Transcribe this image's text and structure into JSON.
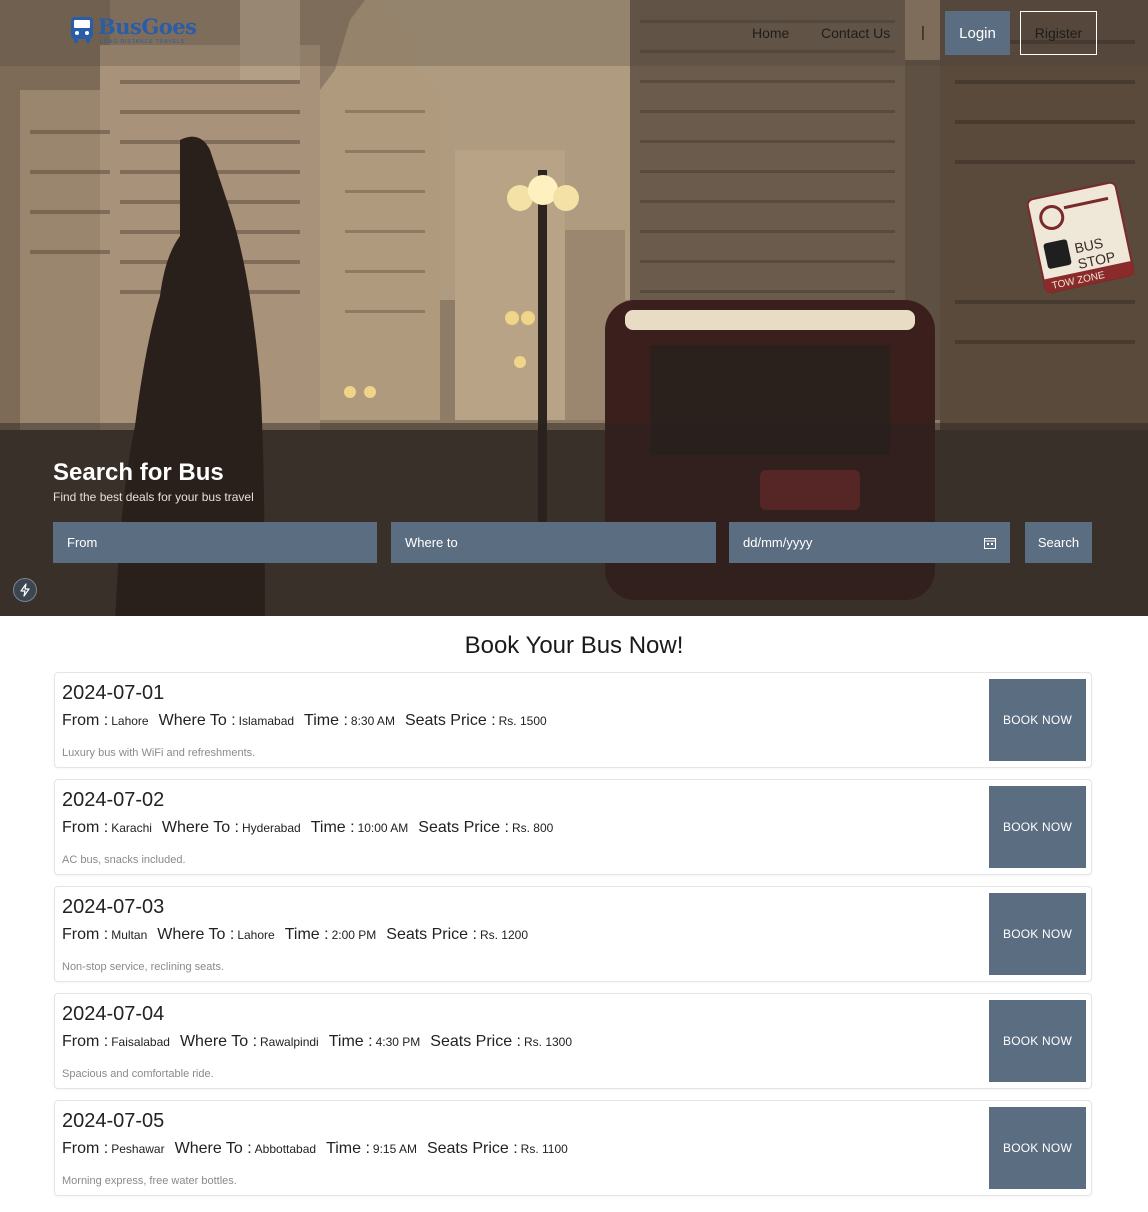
{
  "brand": {
    "name": "BusGoes",
    "tagline": "LONG DISTANCE TRAVELS"
  },
  "nav": {
    "links": [
      "Home",
      "Contact Us"
    ],
    "separator": "|",
    "login_label": "Login",
    "register_label": "Rigister"
  },
  "search": {
    "title": "Search for Bus",
    "subtitle": "Find the best deals for your bus travel",
    "from_placeholder": "From",
    "to_placeholder": "Where to",
    "date_placeholder": "dd/mm/yyyy",
    "search_label": "Search"
  },
  "trips_section": {
    "title": "Book Your Bus Now!",
    "labels": {
      "from": "From :",
      "to": "Where To :",
      "time": "Time :",
      "price": "Seats Price :"
    },
    "book_label": "BOOK NOW",
    "trips": [
      {
        "date": "2024-07-01",
        "from": "Lahore",
        "to": "Islamabad",
        "time": "8:30 AM",
        "price": "Rs. 1500",
        "description": "Luxury bus with WiFi and refreshments."
      },
      {
        "date": "2024-07-02",
        "from": "Karachi",
        "to": "Hyderabad",
        "time": "10:00 AM",
        "price": "Rs. 800",
        "description": "AC bus, snacks included."
      },
      {
        "date": "2024-07-03",
        "from": "Multan",
        "to": "Lahore",
        "time": "2:00 PM",
        "price": "Rs. 1200",
        "description": "Non-stop service, reclining seats."
      },
      {
        "date": "2024-07-04",
        "from": "Faisalabad",
        "to": "Rawalpindi",
        "time": "4:30 PM",
        "price": "Rs. 1300",
        "description": "Spacious and comfortable ride."
      },
      {
        "date": "2024-07-05",
        "from": "Peshawar",
        "to": "Abbottabad",
        "time": "9:15 AM",
        "price": "Rs. 1100",
        "description": "Morning express, free water bottles."
      }
    ]
  },
  "colors": {
    "accent": "#5b6d80",
    "brand": "#2a5da8"
  },
  "hero_sign": {
    "line1": "BUS",
    "line2": "STOP",
    "line3": "TOW ZONE"
  }
}
